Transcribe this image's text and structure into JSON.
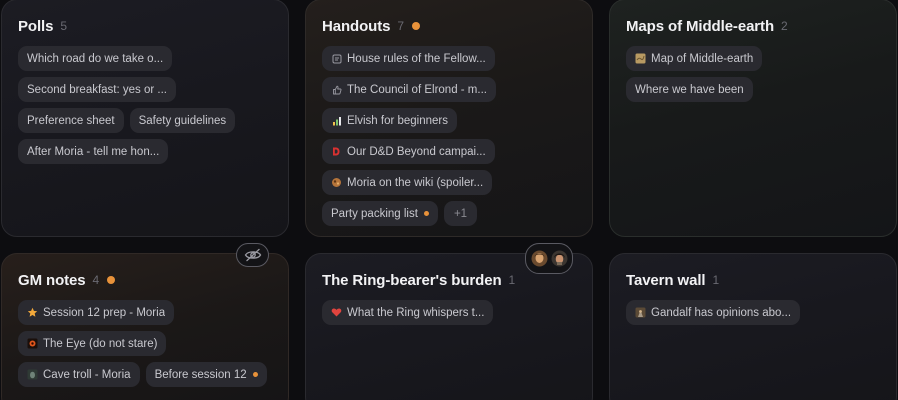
{
  "colors": {
    "accent": "#e8923a",
    "chip_bg": "#2a2a30",
    "title": "#f2f2f4",
    "count": "#6a6a72"
  },
  "boards": [
    {
      "title": "Polls",
      "count": "5",
      "items": [
        {
          "label": "Which road do we take o..."
        },
        {
          "label": "Second breakfast: yes or ..."
        },
        {
          "label": "Preference sheet"
        },
        {
          "label": "Safety guidelines"
        },
        {
          "label": "After Moria - tell me hon..."
        }
      ]
    },
    {
      "title": "Handouts",
      "count": "7",
      "unread": true,
      "items": [
        {
          "label": "House rules of the Fellow...",
          "icon": "document-icon"
        },
        {
          "label": "The Council of Elrond - m...",
          "icon": "thumbs-up-icon"
        },
        {
          "label": "Elvish for beginners",
          "icon": "bar-chart-icon"
        },
        {
          "label": "Our D&D Beyond campai...",
          "icon": "dnd-beyond-icon"
        },
        {
          "label": "Moria on the wiki (spoiler...",
          "icon": "wiki-icon"
        },
        {
          "label": "Party packing list",
          "unread": true
        },
        {
          "label": "+1"
        }
      ]
    },
    {
      "title": "Maps of Middle-earth",
      "count": "2",
      "items": [
        {
          "label": "Map of Middle-earth",
          "icon": "map-thumbnail-icon"
        },
        {
          "label": "Where we have been"
        }
      ]
    },
    {
      "title": "GM notes",
      "count": "4",
      "unread": true,
      "hidden_icon": "eye-off-icon",
      "items": [
        {
          "label": "Session 12 prep - Moria",
          "icon": "star-icon"
        },
        {
          "label": "The Eye (do not stare)",
          "icon": "eye-thumbnail-icon"
        },
        {
          "label": "Cave troll - Moria",
          "icon": "troll-thumbnail-icon"
        },
        {
          "label": "Before session 12",
          "unread": true
        }
      ]
    },
    {
      "title": "The Ring-bearer's burden",
      "count": "1",
      "members": [
        "avatar-1",
        "avatar-2"
      ],
      "items": [
        {
          "label": "What the Ring whispers t...",
          "icon": "heart-icon"
        }
      ]
    },
    {
      "title": "Tavern wall",
      "count": "1",
      "items": [
        {
          "label": "Gandalf has opinions abo...",
          "icon": "gandalf-thumbnail-icon"
        }
      ]
    }
  ]
}
